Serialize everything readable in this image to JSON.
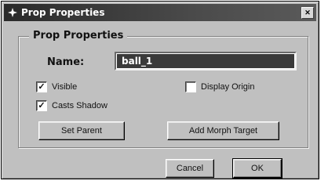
{
  "window": {
    "title": "Prop Properties",
    "close_glyph": "✕"
  },
  "group": {
    "legend": "Prop Properties"
  },
  "name": {
    "label": "Name:",
    "value": "ball_1"
  },
  "checkboxes": {
    "visible": {
      "label": "Visible",
      "checked": true
    },
    "casts_shadow": {
      "label": "Casts Shadow",
      "checked": true
    },
    "display_origin": {
      "label": "Display Origin",
      "checked": false
    }
  },
  "buttons": {
    "set_parent": "Set Parent",
    "add_morph_target": "Add Morph Target",
    "cancel": "Cancel",
    "ok": "OK"
  },
  "icons": {
    "title_icon": "prop-icon",
    "close_icon": "close-icon",
    "check_icon": "checkmark-icon"
  }
}
